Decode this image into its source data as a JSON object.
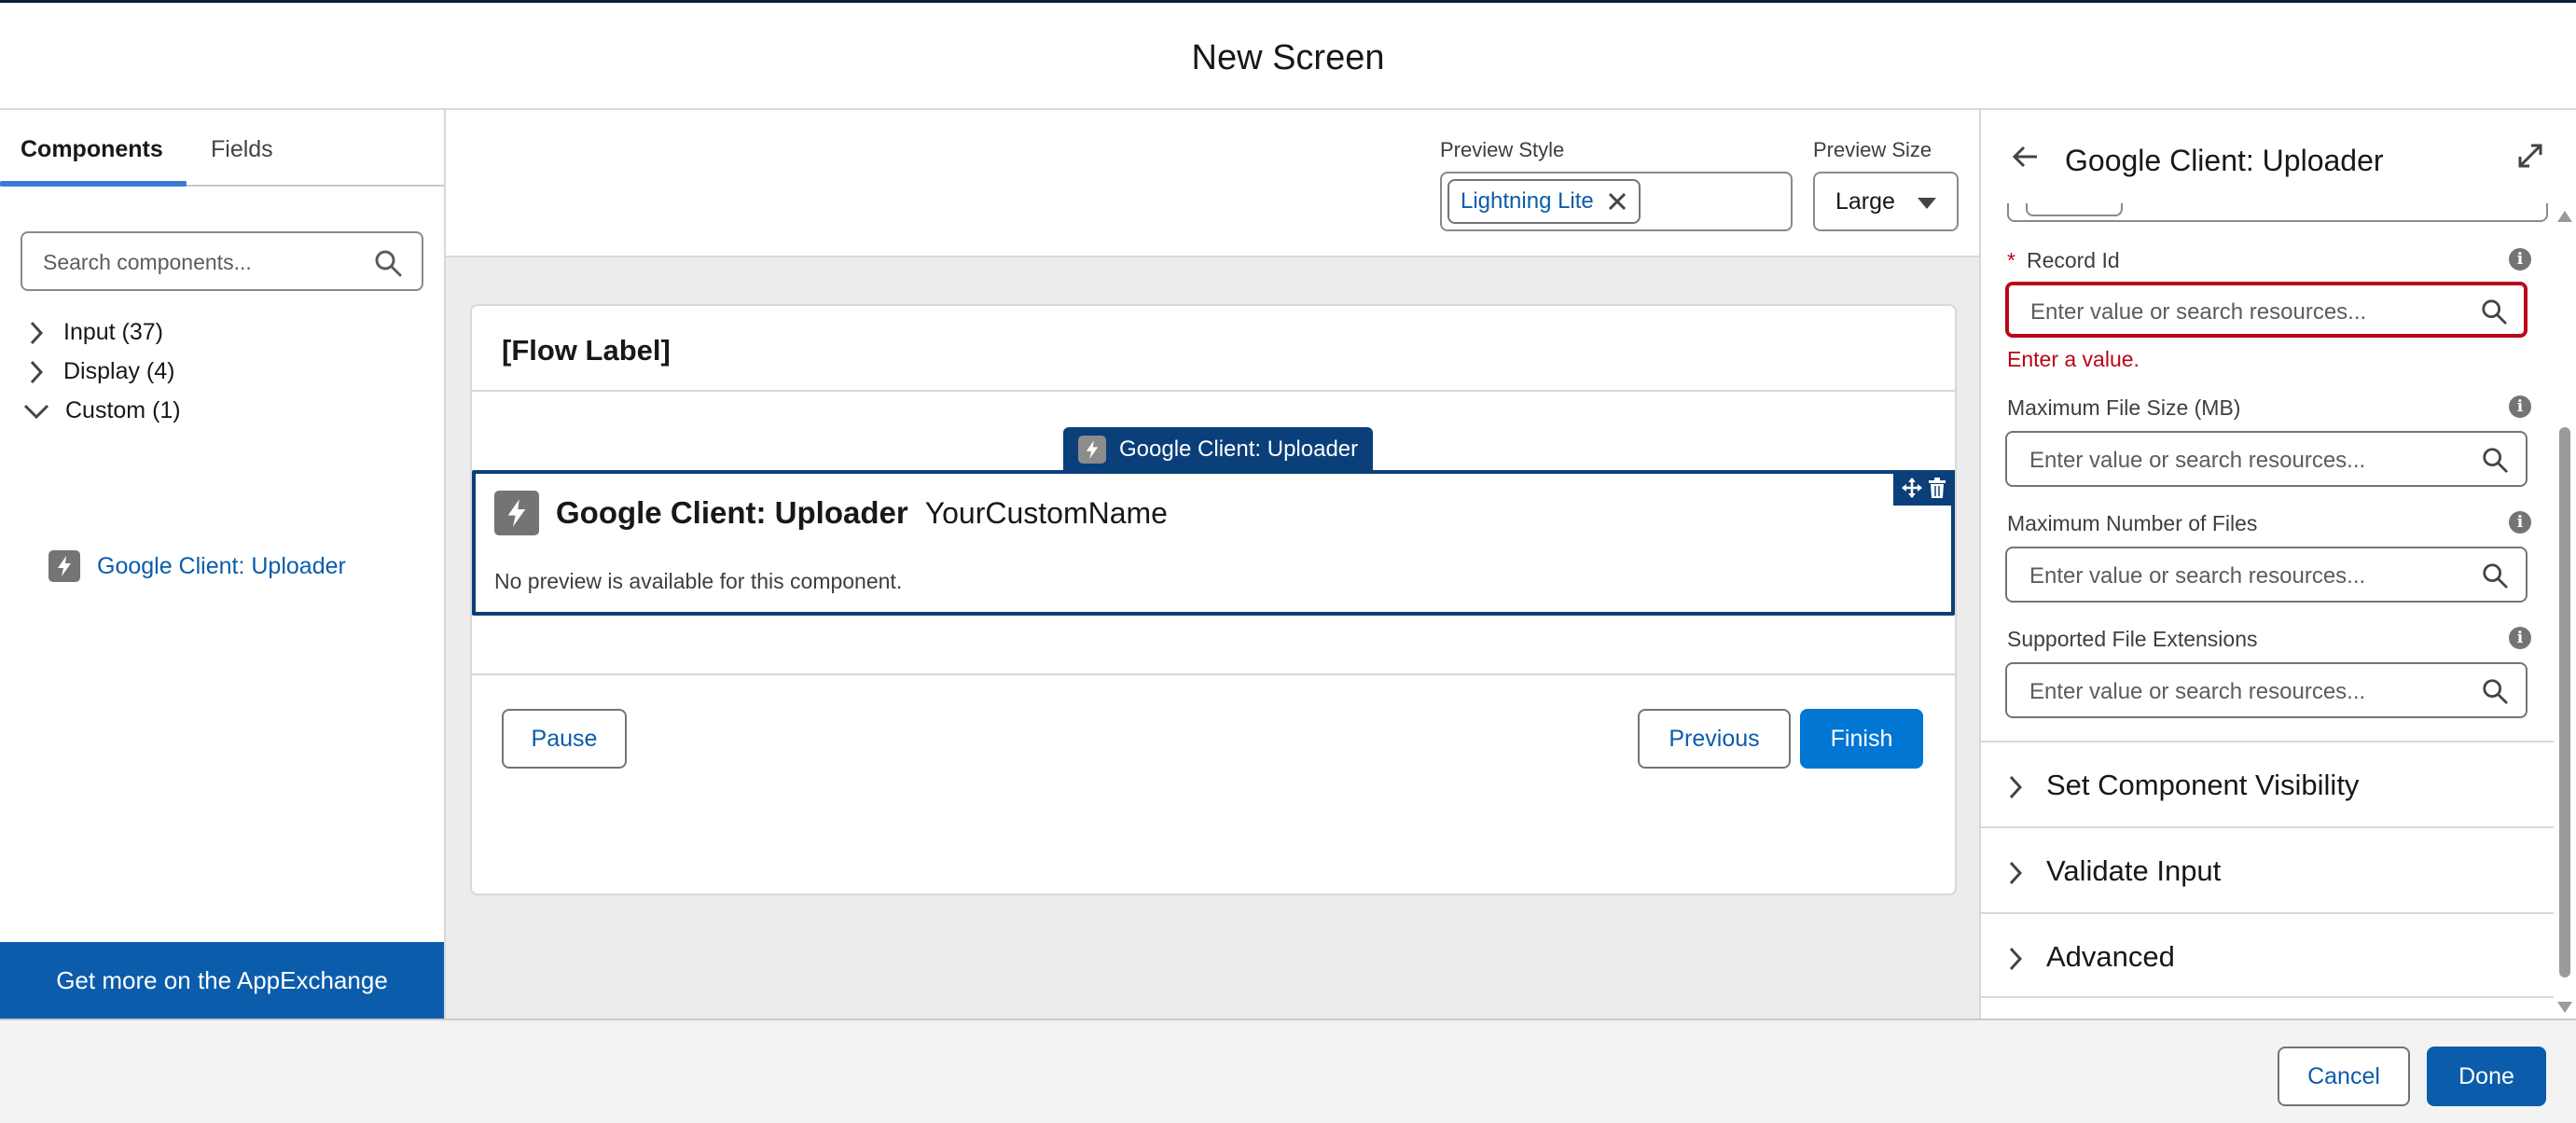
{
  "header": {
    "title": "New Screen"
  },
  "left_panel": {
    "tabs": [
      {
        "label": "Components"
      },
      {
        "label": "Fields"
      }
    ],
    "search": {
      "placeholder": "Search components..."
    },
    "tree": [
      {
        "label": "Input (37)",
        "expanded": false
      },
      {
        "label": "Display (4)",
        "expanded": false
      },
      {
        "label": "Custom (1)",
        "expanded": true
      }
    ],
    "custom_component": "Google Client: Uploader",
    "appexchange_label": "Get more on the AppExchange"
  },
  "preview": {
    "style_label": "Preview Style",
    "style_value": "Lightning Lite",
    "size_label": "Preview Size",
    "size_value": "Large"
  },
  "canvas": {
    "flow_label": "[Flow Label]",
    "component_tag": "Google Client: Uploader",
    "component_name": "Google Client: Uploader",
    "component_api_name": "YourCustomName",
    "no_preview_text": "No preview is available for this component.",
    "pause_label": "Pause",
    "previous_label": "Previous",
    "finish_label": "Finish"
  },
  "properties": {
    "title": "Google Client: Uploader",
    "fields": [
      {
        "label": "Record Id",
        "required": true,
        "placeholder": "Enter value or search resources...",
        "error": "Enter a value."
      },
      {
        "label": "Maximum File Size (MB)",
        "required": false,
        "placeholder": "Enter value or search resources..."
      },
      {
        "label": "Maximum Number of Files",
        "required": false,
        "placeholder": "Enter value or search resources..."
      },
      {
        "label": "Supported File Extensions",
        "required": false,
        "placeholder": "Enter value or search resources..."
      }
    ],
    "sections": [
      {
        "label": "Set Component Visibility"
      },
      {
        "label": "Validate Input"
      },
      {
        "label": "Advanced"
      }
    ]
  },
  "footer": {
    "cancel_label": "Cancel",
    "done_label": "Done"
  },
  "colors": {
    "brand": "#0176d3",
    "brand_dark": "#0b5cab",
    "error": "#ba0517",
    "selection_border": "#0b3f7a"
  }
}
